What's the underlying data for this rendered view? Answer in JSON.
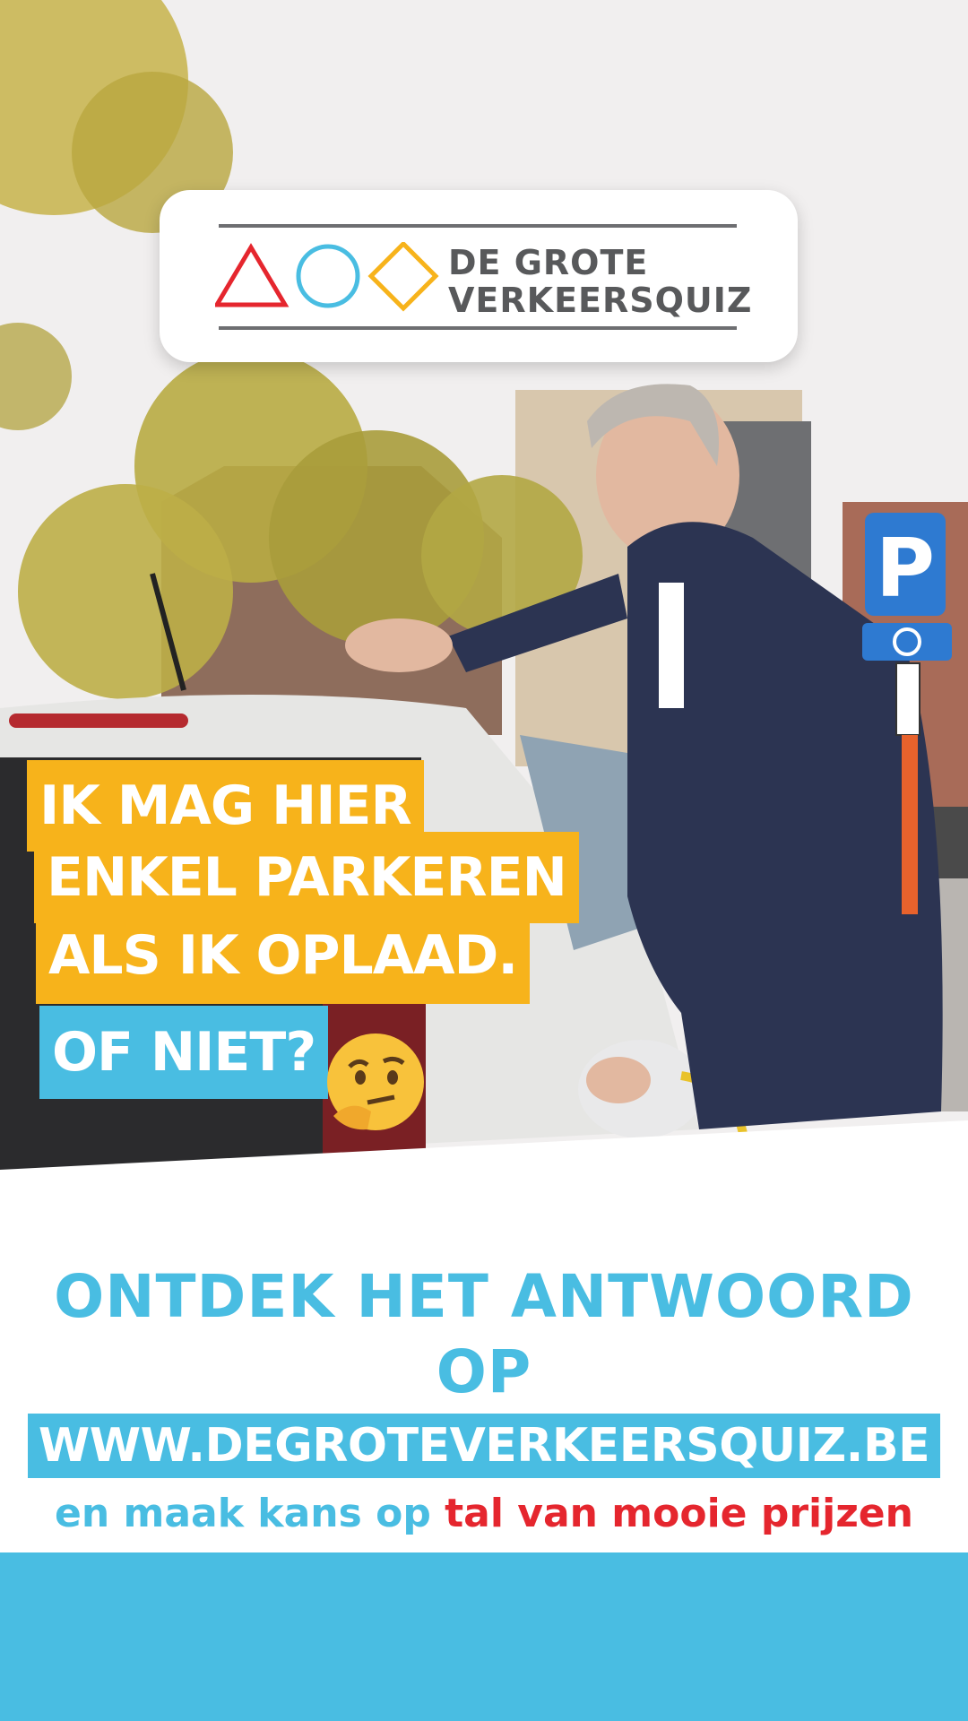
{
  "logo": {
    "line1": "DE GROTE",
    "line2": "VERKEERSQUIZ",
    "shapes": [
      "triangle-red",
      "circle-blue",
      "diamond-yellow"
    ]
  },
  "question": {
    "line1": "IK MAG HIER",
    "line2": "ENKEL PARKEREN",
    "line3": "ALS IK OPLAAD.",
    "line4": "OF NIET?"
  },
  "emoji": "thinking-face",
  "sign": {
    "parking_letter": "P"
  },
  "cta": {
    "line1": "ONTDEK HET ANTWOORD OP",
    "url": "WWW.DEGROTEVERKEERSQUIZ.BE",
    "line3_part1": "en maak kans op ",
    "line3_part2": "tal van mooie prijzen"
  },
  "colors": {
    "blue": "#49bde2",
    "yellow": "#f7b31b",
    "red": "#e5262e",
    "grey": "#58595b"
  }
}
